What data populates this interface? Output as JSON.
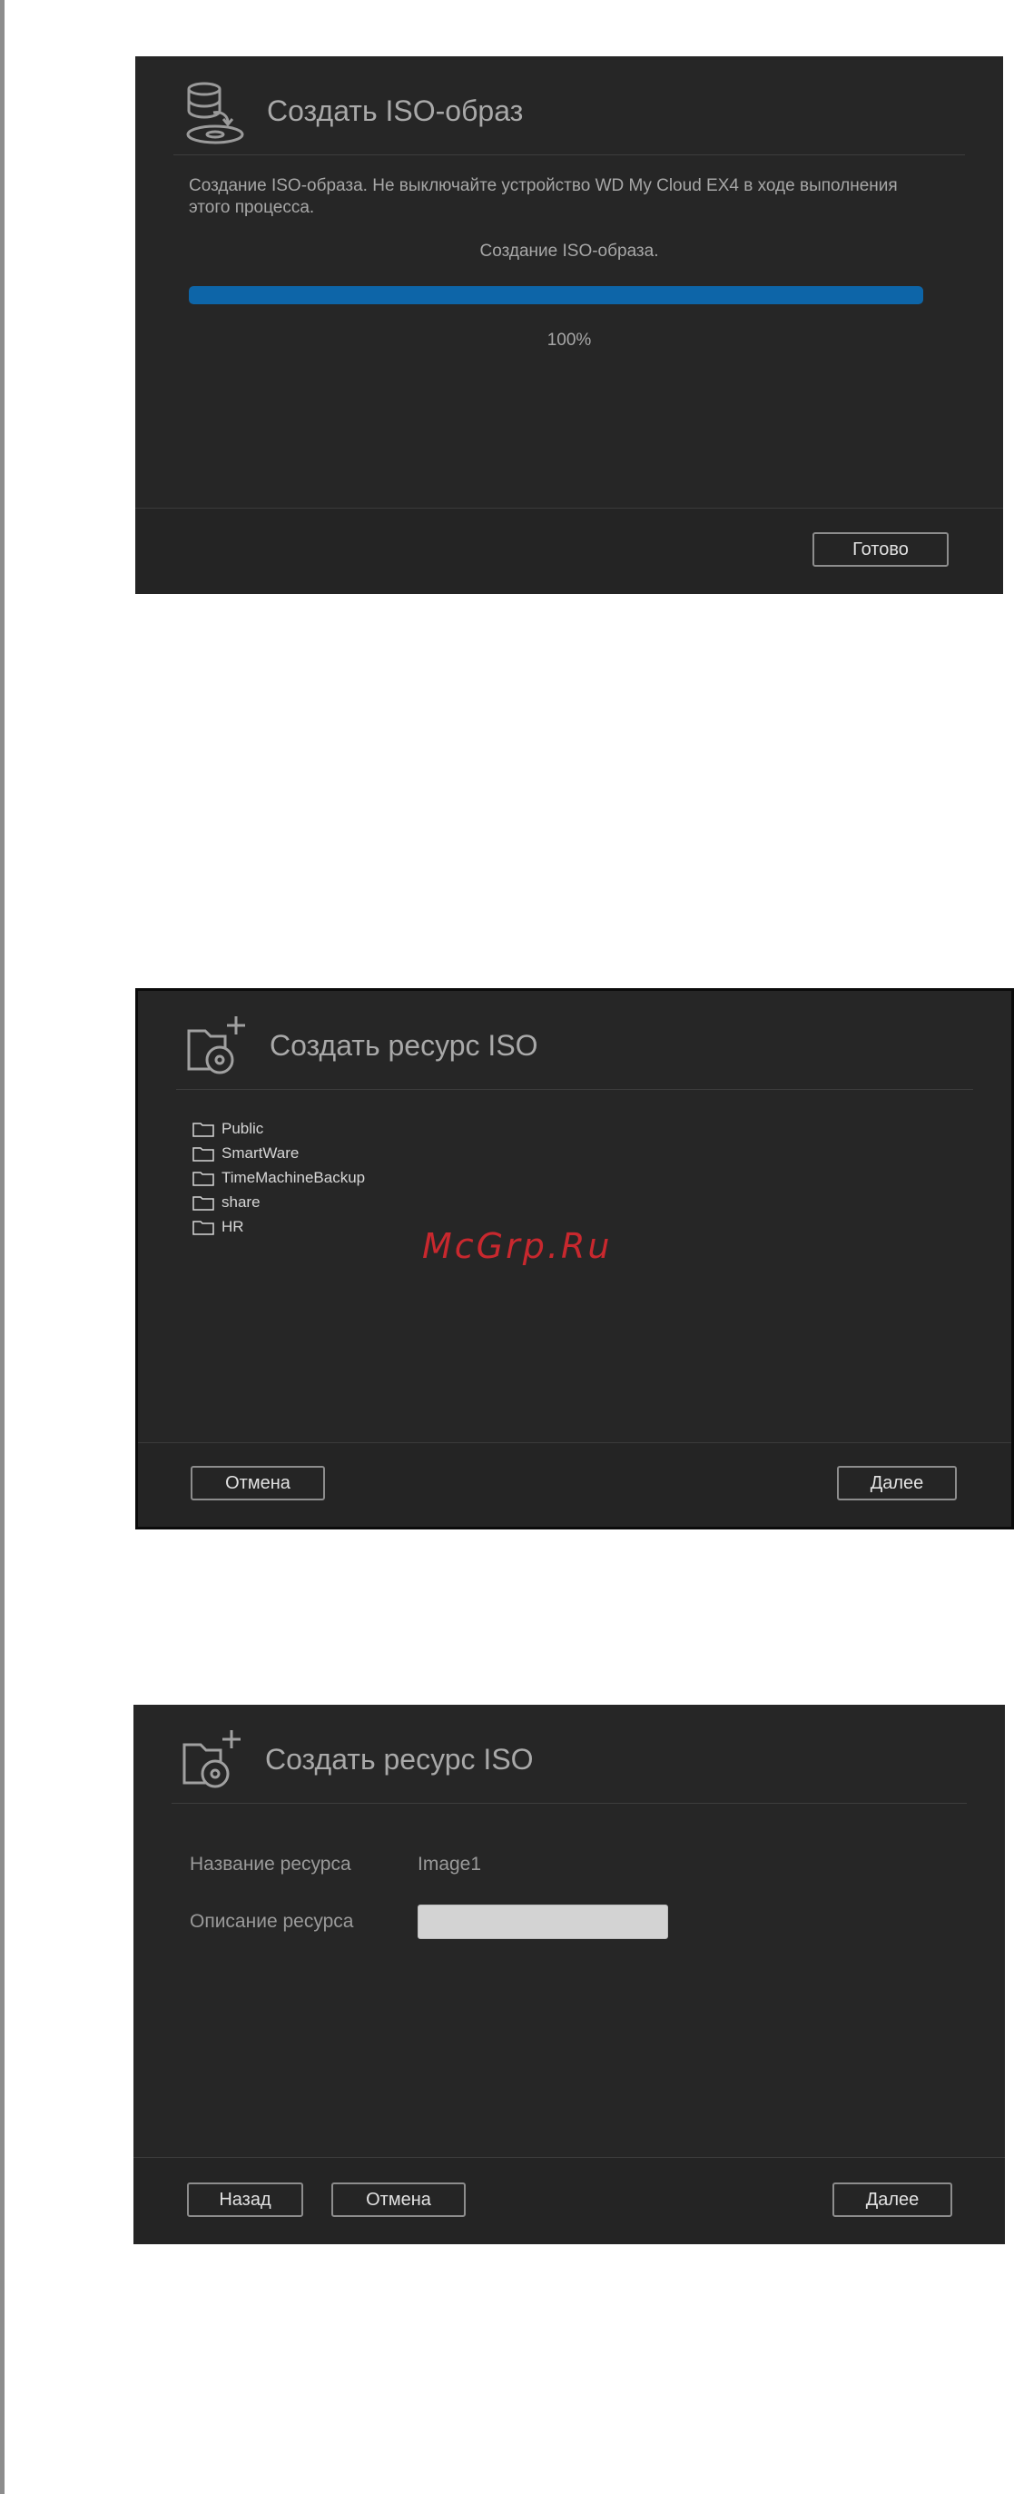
{
  "dialog_iso_image": {
    "title": "Создать ISO-образ",
    "message": "Создание ISO-образа. Не выключайте устройство WD My Cloud EX4 в ходе выполнения этого процесса.",
    "status": "Создание ISO-образа.",
    "progress_percent": 100,
    "progress_label": "100%",
    "done_button": "Готово",
    "progress_color": "#0d65a8"
  },
  "dialog_iso_share_folders": {
    "title": "Создать ресурс ISO",
    "folders": [
      "Public",
      "SmartWare",
      "TimeMachineBackup",
      "share",
      "HR"
    ],
    "cancel_button": "Отмена",
    "next_button": "Далее"
  },
  "dialog_iso_share_details": {
    "title": "Создать ресурс ISO",
    "name_label": "Название ресурса",
    "name_value": "Image1",
    "description_label": "Описание ресурса",
    "description_value": "",
    "back_button": "Назад",
    "cancel_button": "Отмена",
    "next_button": "Далее"
  },
  "watermark": "McGrp.Ru",
  "colors": {
    "dialog_background": "#262626",
    "watermark": "#c8282e"
  }
}
